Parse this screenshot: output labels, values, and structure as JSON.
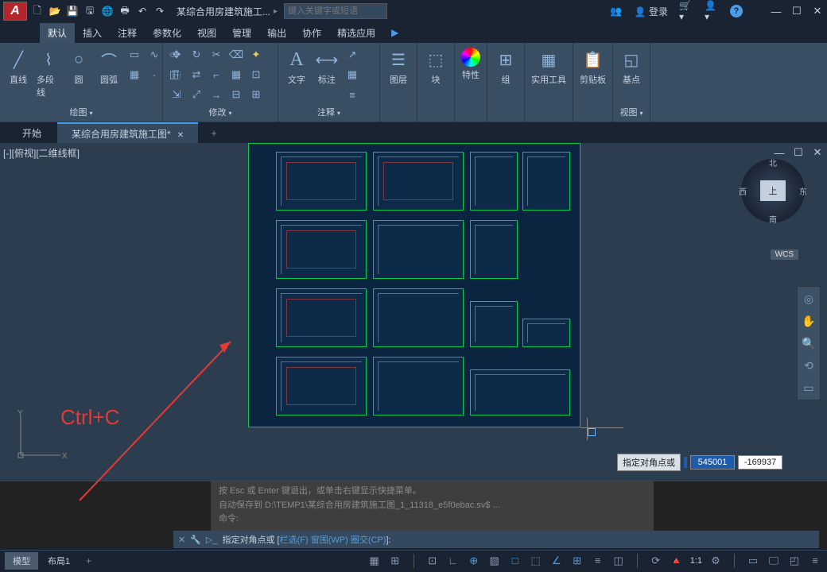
{
  "app": {
    "logo_letter": "A",
    "title": "某综合用房建筑施工...",
    "search_placeholder": "键入关键字或短语",
    "login": "登录"
  },
  "menu": {
    "items": [
      "默认",
      "插入",
      "注释",
      "参数化",
      "视图",
      "管理",
      "输出",
      "协作",
      "精选应用"
    ],
    "active": 0
  },
  "ribbon": {
    "panels": [
      {
        "label": "绘图",
        "big": [
          {
            "icon": "line",
            "label": "直线"
          },
          {
            "icon": "pline",
            "label": "多段线"
          },
          {
            "icon": "circle",
            "label": "圆"
          },
          {
            "icon": "arc",
            "label": "圆弧"
          }
        ]
      },
      {
        "label": "修改"
      },
      {
        "label": "注释",
        "big": [
          {
            "icon": "text",
            "label": "文字"
          },
          {
            "icon": "dim",
            "label": "标注"
          }
        ]
      },
      {
        "label": "图层",
        "big": [
          {
            "icon": "layers",
            "label": "图层"
          }
        ]
      },
      {
        "label": "块",
        "big": [
          {
            "icon": "block",
            "label": "块"
          }
        ]
      },
      {
        "label": "特性",
        "big": [
          {
            "icon": "props",
            "label": "特性"
          }
        ]
      },
      {
        "label": "组",
        "big": [
          {
            "icon": "group",
            "label": "组"
          }
        ]
      },
      {
        "label": "实用工具",
        "big": [
          {
            "icon": "util",
            "label": "实用工具"
          }
        ]
      },
      {
        "label": "剪贴板",
        "big": [
          {
            "icon": "clip",
            "label": "剪贴板"
          }
        ]
      },
      {
        "label": "视图",
        "big": [
          {
            "icon": "view",
            "label": "基点"
          }
        ]
      }
    ]
  },
  "tabs": {
    "items": [
      {
        "label": "开始",
        "active": false
      },
      {
        "label": "某综合用房建筑施工图*",
        "active": true
      }
    ]
  },
  "viewport": {
    "label": "[-][俯视][二维线框]"
  },
  "viewcube": {
    "n": "北",
    "s": "南",
    "e": "东",
    "w": "西",
    "top": "上"
  },
  "wcs": "WCS",
  "coord": {
    "label": "指定对角点或",
    "x": "545001",
    "y": "-169937"
  },
  "cmd": {
    "hist1": "按 Esc 或 Enter 键退出，或单击右键显示快捷菜单。",
    "hist2": "自动保存到 D:\\TEMP1\\某综合用房建筑施工图_1_11318_e5f0ebac.sv$ ...",
    "hist3": "命令:",
    "prompt_pre": "指定对角点或 [",
    "opt1": "栏选(F)",
    "opt2": "窗围(WP)",
    "opt3": "圈交(CP)",
    "prompt_post": "]:"
  },
  "status": {
    "tabs": [
      {
        "label": "模型",
        "active": true
      },
      {
        "label": "布局1",
        "active": false
      }
    ],
    "scale": "1:1"
  },
  "annotation": {
    "text": "Ctrl+C"
  }
}
